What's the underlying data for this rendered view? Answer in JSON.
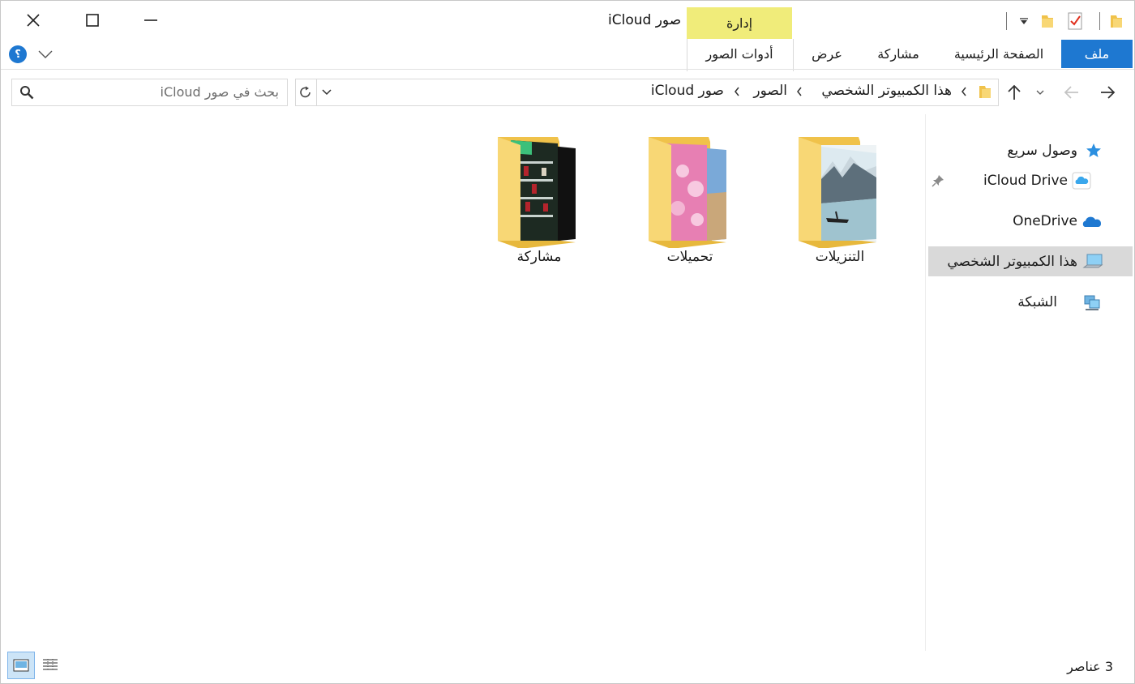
{
  "window": {
    "title": "صور iCloud",
    "context_tab": "إدارة"
  },
  "ribbon": {
    "tabs": [
      {
        "label": "ملف",
        "selected": true
      },
      {
        "label": "الصفحة الرئيسية"
      },
      {
        "label": "مشاركة"
      },
      {
        "label": "عرض"
      },
      {
        "label": "أدوات الصور"
      }
    ],
    "help_badge": "؟"
  },
  "address": {
    "breadcrumb": [
      "هذا الكمبيوتر الشخصي",
      "الصور",
      "صور iCloud"
    ]
  },
  "search": {
    "placeholder": "بحث في صور iCloud"
  },
  "sidebar": {
    "items": [
      {
        "label": "وصول سريع",
        "icon": "star-icon"
      },
      {
        "label": "iCloud Drive",
        "icon": "icloud-icon",
        "pinned": true
      },
      {
        "label": "OneDrive",
        "icon": "onedrive-cloud-icon"
      },
      {
        "label": "هذا الكمبيوتر الشخصي",
        "icon": "computer-icon",
        "selected": true
      },
      {
        "label": "الشبكة",
        "icon": "network-icon"
      }
    ]
  },
  "content": {
    "folders": [
      {
        "label": "التنزيلات",
        "preview": "mountain-lake"
      },
      {
        "label": "تحميلات",
        "preview": "pink-beach"
      },
      {
        "label": "مشاركة",
        "preview": "store-shelves"
      }
    ]
  },
  "status": {
    "item_count": "3 عناصر"
  },
  "colors": {
    "accent": "#1e78d1",
    "context_tab": "#f0ec7a",
    "selection": "#d9d9d9",
    "folder": "#f8d775"
  }
}
